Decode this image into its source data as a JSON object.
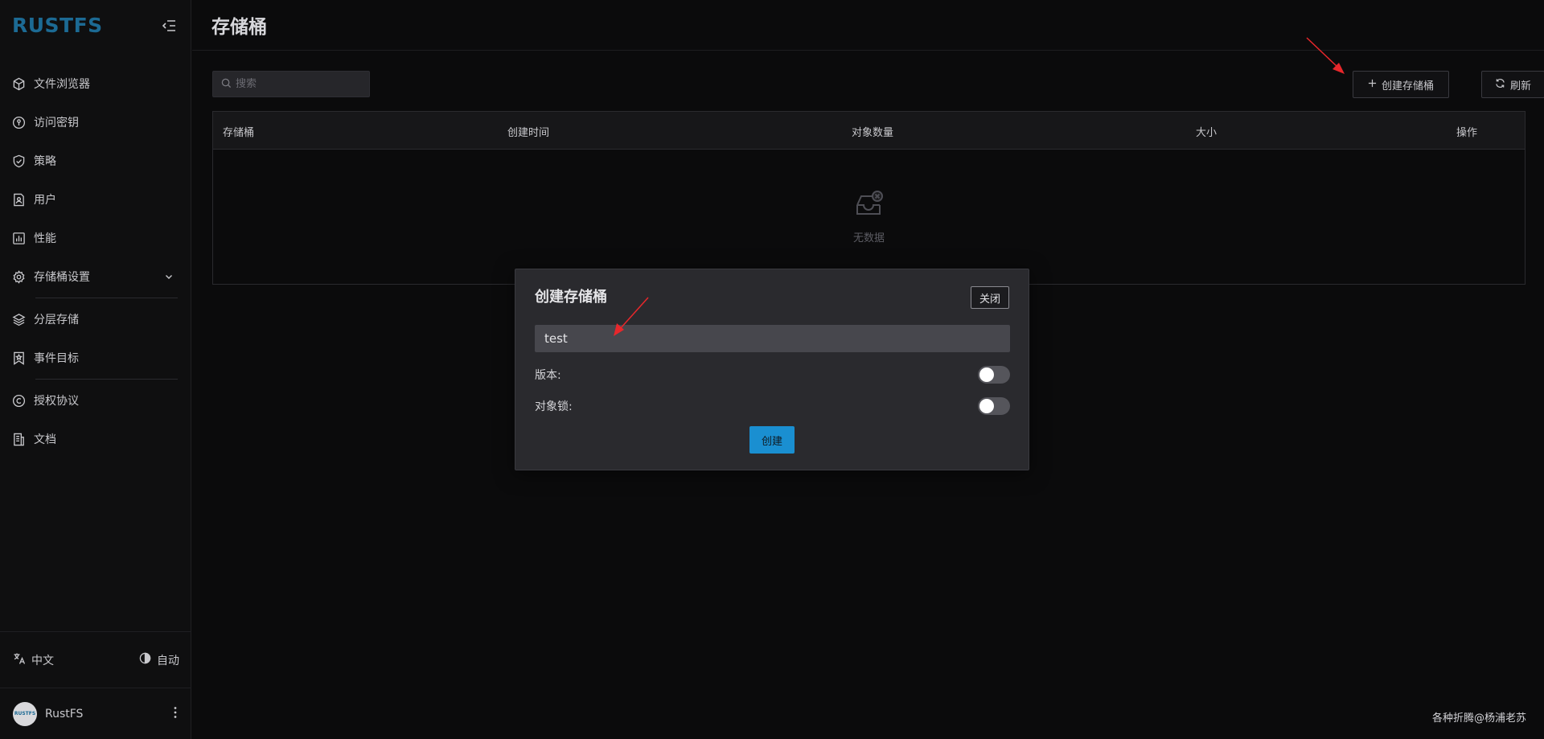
{
  "sidebar": {
    "logo": "RUSTFS",
    "items": [
      {
        "label": "文件浏览器",
        "icon": "cube-icon"
      },
      {
        "label": "访问密钥",
        "icon": "key-circle-icon"
      },
      {
        "label": "策略",
        "icon": "shield-check-icon"
      },
      {
        "label": "用户",
        "icon": "user-card-icon"
      },
      {
        "label": "性能",
        "icon": "bar-chart-icon"
      },
      {
        "label": "存储桶设置",
        "icon": "gear-icon"
      },
      {
        "label": "分层存储",
        "icon": "layers-icon"
      },
      {
        "label": "事件目标",
        "icon": "bookmark-star-icon"
      },
      {
        "label": "授权协议",
        "icon": "copyright-icon"
      },
      {
        "label": "文档",
        "icon": "document-icon"
      }
    ],
    "language": "中文",
    "theme": "自动",
    "user_name": "RustFS",
    "avatar_text": "RUSTFS"
  },
  "header": {
    "title": "存储桶"
  },
  "toolbar": {
    "search_placeholder": "搜索",
    "create_label": "创建存储桶",
    "refresh_label": "刷新"
  },
  "table": {
    "columns": [
      "存储桶",
      "创建时间",
      "对象数量",
      "大小",
      "操作"
    ],
    "rows": [],
    "empty_text": "无数据"
  },
  "modal": {
    "title": "创建存储桶",
    "close_label": "关闭",
    "bucket_name": "test",
    "version_label": "版本:",
    "version_enabled": false,
    "object_lock_label": "对象锁:",
    "object_lock_enabled": false,
    "submit_label": "创建"
  },
  "watermark": "各种折腾@杨浦老苏",
  "colors": {
    "accent": "#1a8fd1",
    "logo": "#1c6a94",
    "annotation_arrow": "#e8272b"
  }
}
